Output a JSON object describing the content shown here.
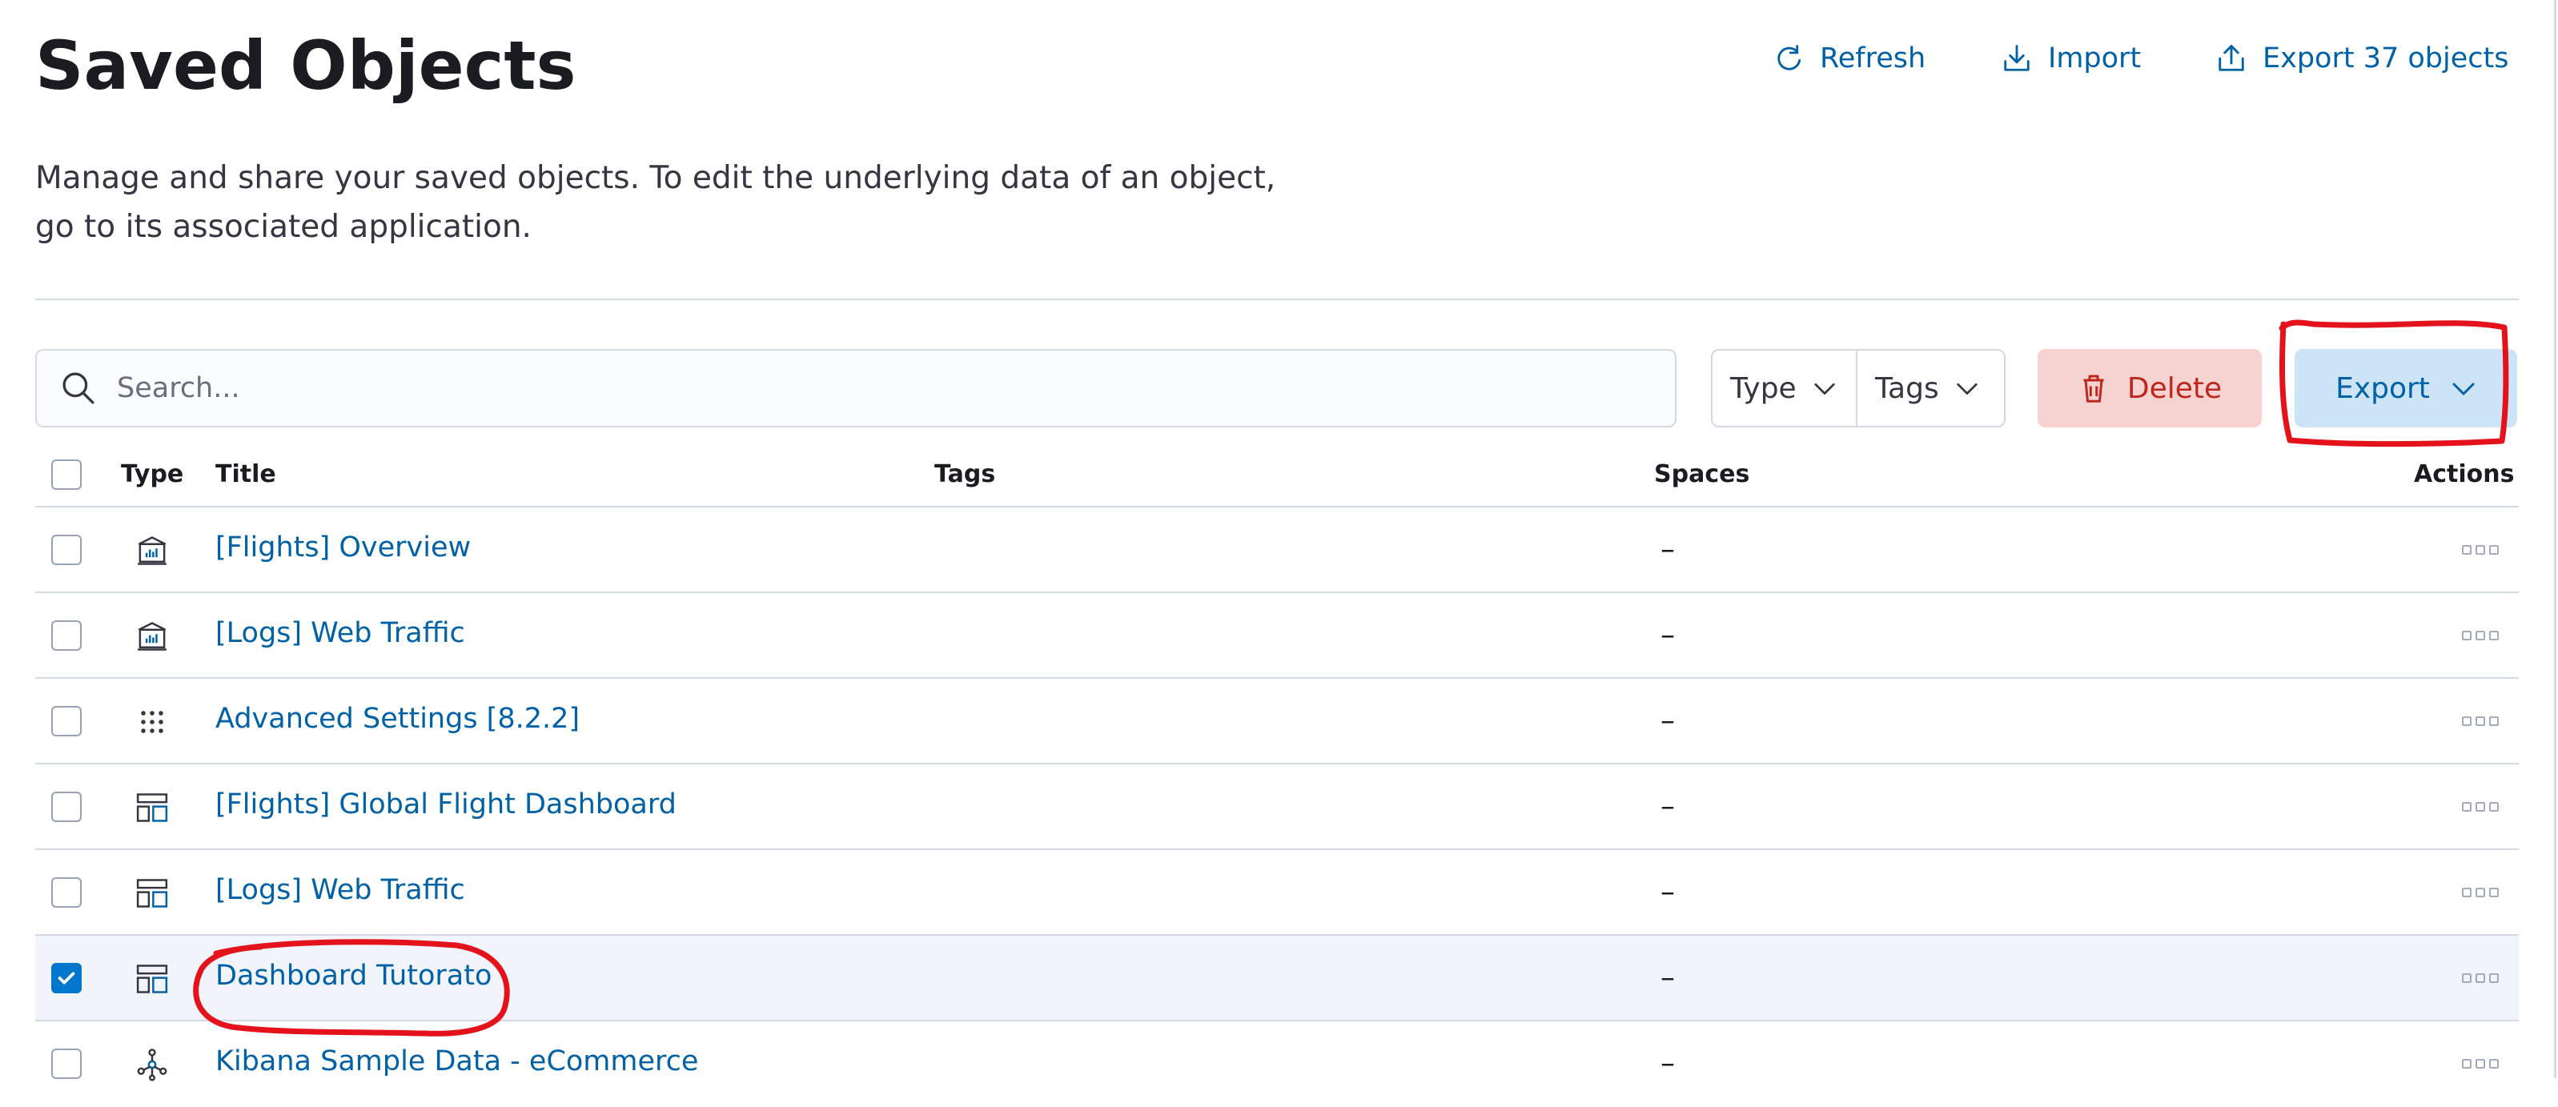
{
  "page": {
    "title": "Saved Objects",
    "description": "Manage and share your saved objects. To edit the underlying data of an object, go to its associated application."
  },
  "header_actions": {
    "refresh_label": "Refresh",
    "import_label": "Import",
    "export_all_label": "Export 37 objects"
  },
  "toolbar": {
    "search_placeholder": "Search...",
    "type_filter_label": "Type",
    "tags_filter_label": "Tags",
    "delete_label": "Delete",
    "export_label": "Export"
  },
  "table": {
    "columns": {
      "type": "Type",
      "title": "Title",
      "tags": "Tags",
      "spaces": "Spaces",
      "actions": "Actions"
    },
    "rows": [
      {
        "type_icon": "visualization-icon",
        "title": "[Flights] Overview",
        "spaces": "–",
        "selected": false
      },
      {
        "type_icon": "visualization-icon",
        "title": "[Logs] Web Traffic",
        "spaces": "–",
        "selected": false
      },
      {
        "type_icon": "advanced-settings-icon",
        "title": "Advanced Settings [8.2.2]",
        "spaces": "–",
        "selected": false
      },
      {
        "type_icon": "dashboard-icon",
        "title": "[Flights] Global Flight Dashboard",
        "spaces": "–",
        "selected": false
      },
      {
        "type_icon": "dashboard-icon",
        "title": "[Logs] Web Traffic",
        "spaces": "–",
        "selected": false
      },
      {
        "type_icon": "dashboard-icon",
        "title": "Dashboard Tutorato",
        "spaces": "–",
        "selected": true
      },
      {
        "type_icon": "index-pattern-icon",
        "title": "Kibana Sample Data - eCommerce",
        "spaces": "–",
        "selected": false
      }
    ]
  },
  "colors": {
    "link": "#0061a6",
    "danger": "#bd271e",
    "annotation": "#e4121b",
    "selected_row": "#f1f4fa"
  }
}
